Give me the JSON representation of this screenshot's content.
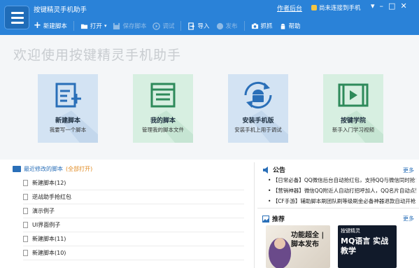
{
  "app": {
    "title": "按键精灵手机助手"
  },
  "topbar": {
    "work_hall": "作者后台",
    "phone_status": "尚未连接到手机"
  },
  "toolbar": {
    "new_script": "新建脚本",
    "open": "打开",
    "save": "保存脚本",
    "debug": "调试",
    "import": "导入",
    "publish": "发布",
    "capture": "抓抓",
    "help": "帮助"
  },
  "welcome": {
    "title": "欢迎使用按键精灵手机助手",
    "cards": [
      {
        "title": "新建脚本",
        "subtitle": "我要写一个脚本",
        "icon": "new-script-icon"
      },
      {
        "title": "我的脚本",
        "subtitle": "管理我的脚本文件",
        "icon": "my-scripts-icon"
      },
      {
        "title": "安装手机版",
        "subtitle": "安装手机上用于调试",
        "icon": "android-install-icon"
      },
      {
        "title": "按键学院",
        "subtitle": "新手入门学习视频",
        "icon": "video-academy-icon"
      }
    ]
  },
  "recent": {
    "label": "最近修改的脚本",
    "open_link": "(全部打开)",
    "items": [
      "新建脚本(12)",
      "逆战助手抢红包",
      "演示例子",
      "UI界面例子",
      "新建脚本(11)",
      "新建脚本(10)"
    ]
  },
  "notice": {
    "title": "公告",
    "more": "更多",
    "items": [
      {
        "tag": "【日常必备】",
        "text": "QQ微信后台自动抢红包，支持QQ与微信同时抢！"
      },
      {
        "tag": "【营销神器】",
        "text": "微信QQ附近人自动打招呼加人，QQ名片自动点赞"
      },
      {
        "tag": "【CF手游】",
        "text": "辅助脚本刷团队刷等级刷金必备神器退款自动开枪"
      }
    ]
  },
  "recommend": {
    "title": "推荐",
    "more": "更多",
    "promo1_text": "功能超全 | 脚本发布",
    "promo2_brand": "按键精灵",
    "promo2_text": "MQ语言 实战教学"
  },
  "colors": {
    "primary": "#2a82d8",
    "card_blue": "#d6e6f5",
    "card_green": "#d7efe1",
    "accent_orange": "#e08a20"
  }
}
